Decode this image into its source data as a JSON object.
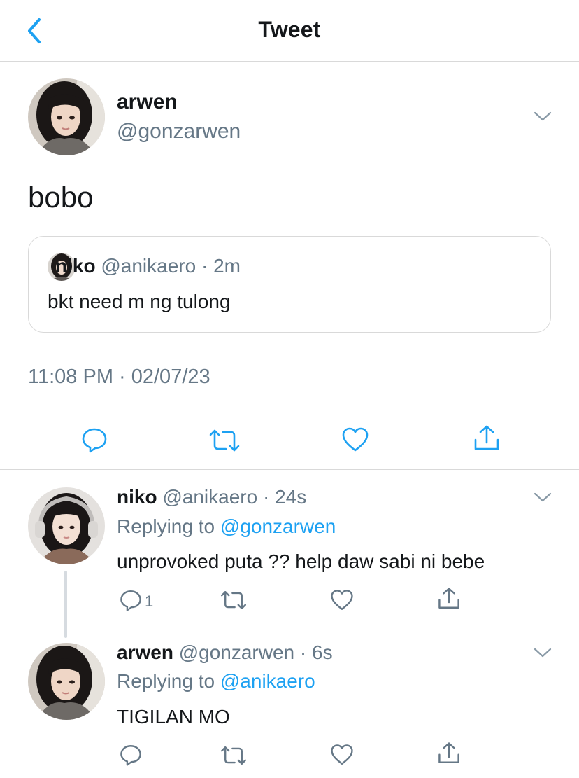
{
  "header": {
    "title": "Tweet",
    "back_icon": "chevron-left-icon"
  },
  "main_tweet": {
    "name": "arwen",
    "handle": "@gonzarwen",
    "text": "bobo",
    "quoted": {
      "name": "niko",
      "handle": "@anikaero",
      "time": "2m",
      "text": "bkt need m ng tulong"
    },
    "timestamp": "11:08 PM · 02/07/23",
    "actions": [
      "reply-icon",
      "retweet-icon",
      "like-icon",
      "share-icon"
    ]
  },
  "replies": [
    {
      "name": "niko",
      "handle": "@anikaero",
      "time": "24s",
      "replying_label": "Replying to",
      "replying_to": "@gonzarwen",
      "text": "unprovoked puta ?? help daw sabi ni bebe",
      "reply_count": "1"
    },
    {
      "name": "arwen",
      "handle": "@gonzarwen",
      "time": "6s",
      "replying_label": "Replying to",
      "replying_to": "@anikaero",
      "text": "TIGILAN MO",
      "reply_count": ""
    }
  ],
  "colors": {
    "accent": "#1da1f2",
    "muted": "#657786",
    "text": "#14171a",
    "border": "#d9d9d9"
  }
}
